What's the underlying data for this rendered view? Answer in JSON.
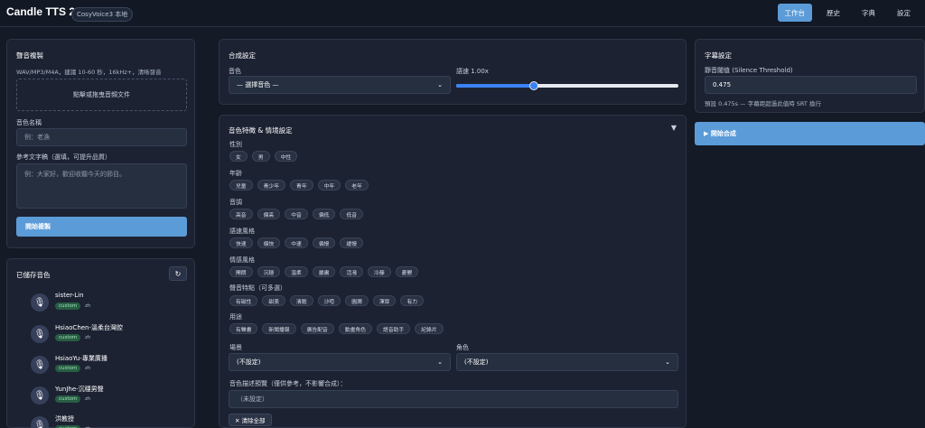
{
  "header": {
    "title": "Candle TTS 2",
    "badge": "CosyVoice3 本地",
    "tabs": [
      "工作台",
      "歷史",
      "字典",
      "設定"
    ]
  },
  "left": {
    "clone": {
      "title": "聲音複製",
      "note": "WAV/MP3/M4A，建議 10-60 秒，16kHz+，清晰發音",
      "upload": "點擊或拖曳音頻文件",
      "name_label": "音色名稱",
      "name_placeholder": "例：老漁",
      "text_label": "參考文字稿（選填，可提升品質）",
      "text_placeholder": "例：大家好，歡迎收聽今天的節目。",
      "button": "開始複製"
    },
    "saved": {
      "title": "已儲存音色",
      "refresh": "↻",
      "voices": [
        {
          "name": "sister-Lin",
          "tag": "custom",
          "lang": "zh"
        },
        {
          "name": "HsiaoChen-溫柔台灣腔",
          "tag": "custom",
          "lang": "zh"
        },
        {
          "name": "HsiaoYu-專業廣播",
          "tag": "custom",
          "lang": "zh"
        },
        {
          "name": "YunJhe-沉穩男聲",
          "tag": "custom",
          "lang": "zh"
        },
        {
          "name": "洪教授",
          "tag": "custom",
          "lang": "zh"
        }
      ]
    }
  },
  "center": {
    "synth": {
      "title": "合成設定",
      "voice_label": "音色",
      "voice_value": "— 選擇音色 —",
      "speed_label": "語速 1.00x",
      "speed_fraction": 0.35
    },
    "traits": {
      "title": "音色特徵 & 情境設定",
      "collapse": "▼",
      "groups": [
        {
          "label": "性別",
          "options": [
            "女",
            "男",
            "中性"
          ]
        },
        {
          "label": "年齡",
          "options": [
            "兒童",
            "青少年",
            "青年",
            "中年",
            "老年"
          ]
        },
        {
          "label": "音調",
          "options": [
            "高音",
            "偏高",
            "中音",
            "偏低",
            "低音"
          ]
        },
        {
          "label": "語速風格",
          "options": [
            "快速",
            "偏快",
            "中速",
            "偏慢",
            "緩慢"
          ]
        },
        {
          "label": "情感風格",
          "options": [
            "開朗",
            "沉穩",
            "溫柔",
            "嚴肅",
            "活潑",
            "冷靜",
            "憂鬱"
          ]
        },
        {
          "label": "聲音特點（可多選）",
          "options": [
            "有磁性",
            "甜美",
            "清脆",
            "沙啞",
            "圓潤",
            "渾厚",
            "有力"
          ]
        },
        {
          "label": "用途",
          "options": [
            "有聲書",
            "新聞播報",
            "廣告配音",
            "動畫角色",
            "語音助手",
            "紀錄片"
          ]
        }
      ],
      "scene_label": "場景",
      "scene_value": "(不設定)",
      "role_label": "角色",
      "role_value": "(不設定)",
      "preview_label": "音色描述預覽（僅供參考，不影響合成）：",
      "preview_value": "（未設定）",
      "clear": "✕ 清除全部"
    }
  },
  "right": {
    "title": "字幕設定",
    "threshold_label": "靜音閾值 (Silence Threshold)",
    "threshold_value": "0.475",
    "threshold_note": "預設 0.475s — 字幕距超過此值時 SRT 換行",
    "start": "▶ 開始合成"
  }
}
